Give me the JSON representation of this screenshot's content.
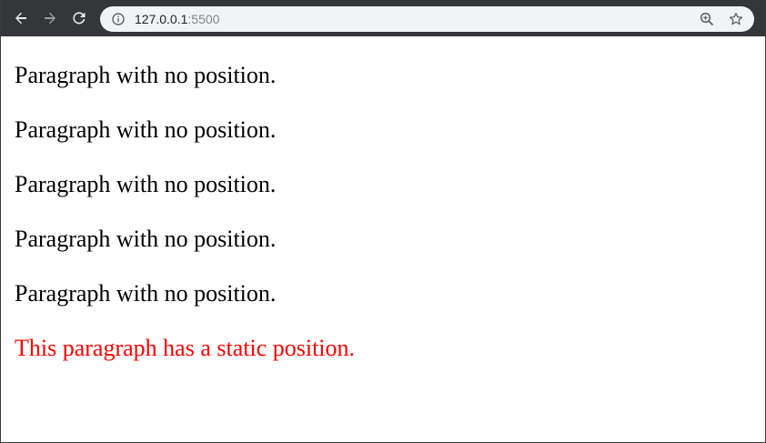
{
  "browser": {
    "url_host": "127.0.0.1",
    "url_port": ":5500",
    "icons": {
      "back": "back-arrow-icon",
      "forward": "forward-arrow-icon",
      "reload": "reload-icon",
      "info": "site-info-icon",
      "zoom": "zoom-icon",
      "bookmark": "bookmark-star-icon"
    }
  },
  "page": {
    "paragraphs": [
      "Paragraph with no position.",
      "Paragraph with no position.",
      "Paragraph with no position.",
      "Paragraph with no position.",
      "Paragraph with no position."
    ],
    "static_paragraph": "This paragraph has a static position.",
    "static_color": "#ff0000"
  }
}
